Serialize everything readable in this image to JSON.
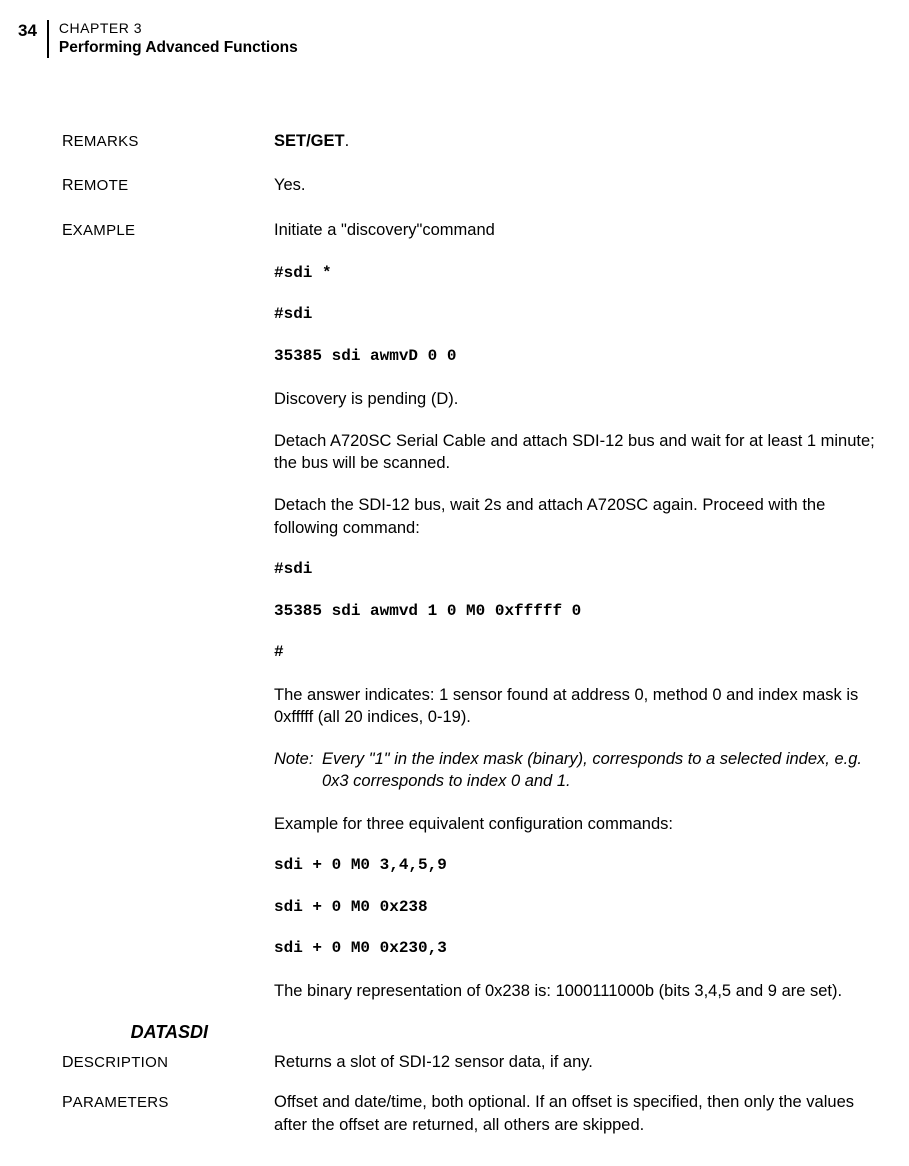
{
  "header": {
    "page_number": "34",
    "chapter_label": "CHAPTER 3",
    "chapter_title": "Performing Advanced Functions"
  },
  "rows": {
    "remarks": {
      "label_big": "R",
      "label_rest": "EMARKS",
      "value_bold": "SET/GET",
      "value_after": "."
    },
    "remote": {
      "label_big": "R",
      "label_rest": "EMOTE",
      "value": "Yes."
    },
    "example": {
      "label_big": "E",
      "label_rest": "XAMPLE",
      "value": "Initiate a \"discovery\"command"
    }
  },
  "example_body": {
    "cmd1": "#sdi *",
    "cmd2": "#sdi",
    "cmd3": "35385 sdi awmvD 0 0",
    "text1": "Discovery is pending (D).",
    "text2": "Detach A720SC Serial Cable and attach SDI-12 bus and wait for at least 1 minute; the bus will be scanned.",
    "text3": "Detach the SDI-12 bus, wait 2s and attach A720SC again. Proceed with the following command:",
    "cmd4": "#sdi",
    "cmd5": "35385 sdi awmvd 1 0 M0 0xfffff 0",
    "cmd6": "#",
    "text4": "The answer indicates: 1 sensor found at address 0, method 0 and index mask is 0xfffff (all 20 indices, 0-19).",
    "note_label": "Note:",
    "note_body": "Every \"1\" in the index mask (binary), corresponds to a selected index, e.g. 0x3 corresponds to index 0 and 1.",
    "text5": "Example for three equivalent configuration commands:",
    "cmd7": "sdi + 0 M0 3,4,5,9",
    "cmd8": "sdi + 0 M0 0x238",
    "cmd9": "sdi + 0 M0 0x230,3",
    "text6": "The binary representation of 0x238 is: 1000111000b (bits 3,4,5 and 9 are set)."
  },
  "section_heading": "DATASDI",
  "rows2": {
    "description": {
      "label_big": "D",
      "label_rest": "ESCRIPTION",
      "value": "Returns a slot of SDI-12 sensor data, if any."
    },
    "parameters": {
      "label_big": "P",
      "label_rest": "ARAMETERS",
      "value": "Offset and date/time, both optional. If an offset is specified, then only the values after the offset are returned, all others are skipped."
    }
  }
}
